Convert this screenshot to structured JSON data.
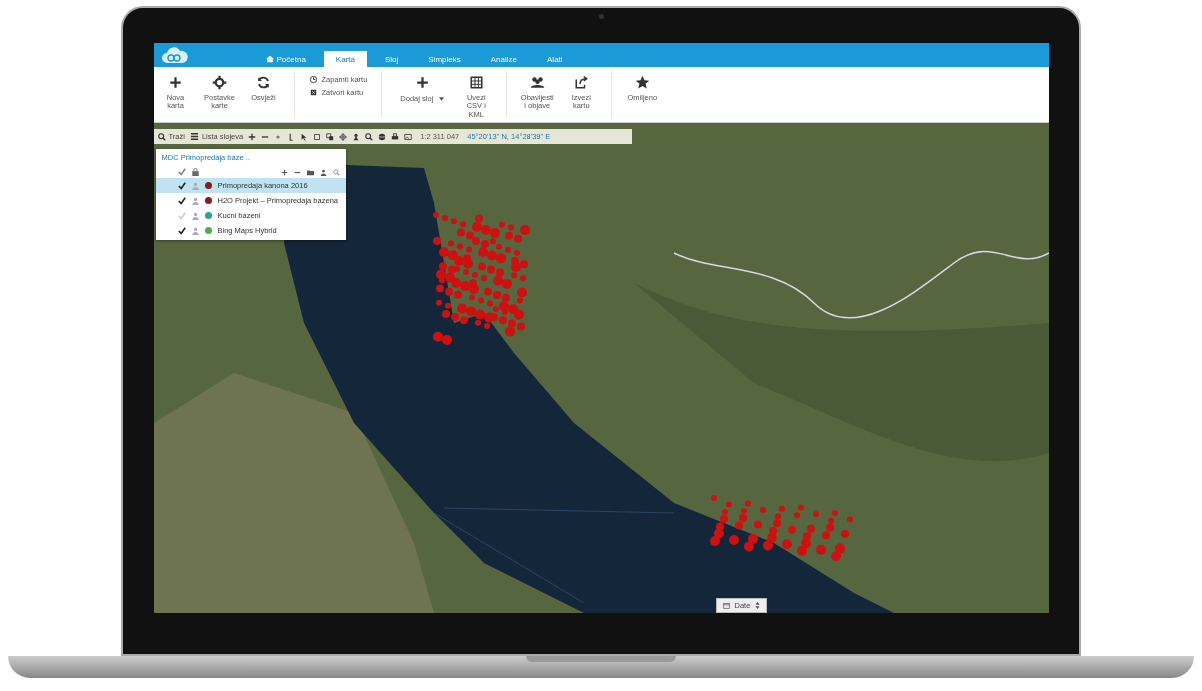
{
  "app": {
    "tabs": [
      {
        "label": "Početna",
        "kind": "home",
        "selected": false
      },
      {
        "label": "Karta",
        "kind": "plain",
        "selected": true
      },
      {
        "label": "Sloj",
        "kind": "plain",
        "selected": false
      },
      {
        "label": "Simpleks",
        "kind": "plain",
        "selected": false
      },
      {
        "label": "Analize",
        "kind": "plain",
        "selected": false
      },
      {
        "label": "Alati",
        "kind": "plain",
        "selected": false
      }
    ],
    "ribbon": [
      {
        "kind": "button",
        "label": "Nova karta"
      },
      {
        "kind": "button",
        "label": "Postavke karte"
      },
      {
        "kind": "button",
        "label": "Osvježi"
      },
      {
        "kind": "stack",
        "entries": [
          {
            "label": "Zapamti kartu"
          },
          {
            "label": "Zatvori kartu"
          }
        ]
      },
      {
        "kind": "dropdown",
        "label": "Dodaj sloj"
      },
      {
        "kind": "button",
        "label": "Uvezi CSV i KML"
      },
      {
        "kind": "button",
        "label": "Obavijesti i objave"
      },
      {
        "kind": "button",
        "label": "Izvezi kartu"
      },
      {
        "kind": "button",
        "label": "Omiljeno"
      }
    ],
    "toolbar": {
      "search": "Traži",
      "layers": "Lista slojeva",
      "scale": "1:2 311 047",
      "coordinates": "45°20'13\" N, 14°28'39\" E"
    },
    "layer_panel": {
      "title": "MDC Primopredaja baze ..",
      "layers": [
        {
          "name": "Primopredaja kanona 2016",
          "visible": true,
          "selected": true,
          "color": "#8b1a1a"
        },
        {
          "name": "H2O Projekt – Primopredaja bazena",
          "visible": true,
          "selected": false,
          "color": "#8b1a1a"
        },
        {
          "name": "Kućni bazeni",
          "visible": false,
          "selected": false,
          "color": "#2aa198"
        },
        {
          "name": "Bing Maps Hybrid",
          "visible": true,
          "selected": false,
          "color": "#4caf50"
        }
      ]
    },
    "date_button": "Date"
  }
}
